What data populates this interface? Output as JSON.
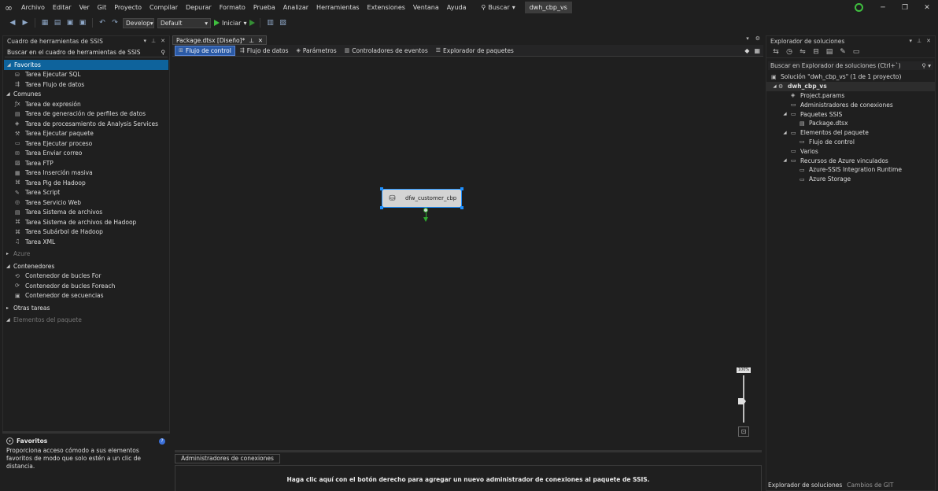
{
  "menubar": {
    "items": [
      "Archivo",
      "Editar",
      "Ver",
      "Git",
      "Proyecto",
      "Compilar",
      "Depurar",
      "Formato",
      "Prueba",
      "Analizar",
      "Herramientas",
      "Extensiones",
      "Ventana",
      "Ayuda"
    ],
    "search_label": "Buscar",
    "project_name": "dwh_cbp_vs"
  },
  "toolbar": {
    "config_combo": "Develop",
    "platform_combo": "Default",
    "start_label": "Iniciar"
  },
  "toolbox": {
    "title": "Cuadro de herramientas de SSIS",
    "search_placeholder": "Buscar en el cuadro de herramientas de SSIS",
    "categories": [
      {
        "label": "Favoritos",
        "items": [
          "Tarea Ejecutar SQL",
          "Tarea Flujo de datos"
        ]
      },
      {
        "label": "Comunes",
        "items": [
          "Tarea de expresión",
          "Tarea de generación de perfiles de datos",
          "Tarea de procesamiento de Analysis Services",
          "Tarea Ejecutar paquete",
          "Tarea Ejecutar proceso",
          "Tarea Enviar correo",
          "Tarea FTP",
          "Tarea Inserción masiva",
          "Tarea Pig de Hadoop",
          "Tarea Script",
          "Tarea Servicio Web",
          "Tarea Sistema de archivos",
          "Tarea Sistema de archivos de Hadoop",
          "Tarea Subárbol de Hadoop",
          "Tarea XML"
        ]
      },
      {
        "label": "Azure",
        "items": []
      },
      {
        "label": "Contenedores",
        "items": [
          "Contenedor de bucles For",
          "Contenedor de bucles Foreach",
          "Contenedor de secuencias"
        ]
      },
      {
        "label": "Otras tareas",
        "items": []
      },
      {
        "label": "Elementos del paquete",
        "items": []
      }
    ],
    "desc_title": "Favoritos",
    "desc_text": "Proporciona acceso cómodo a sus elementos favoritos de modo que solo estén a un clic de distancia."
  },
  "document": {
    "tab_label": "Package.dtsx [Diseño]*",
    "designer_tabs": [
      "Flujo de control",
      "Flujo de datos",
      "Parámetros",
      "Controladores de eventos",
      "Explorador de paquetes"
    ],
    "task_label": "dfw_customer_cbp",
    "zoom_label": "100%",
    "conn_tab": "Administradores de conexiones",
    "conn_message": "Haga clic aquí con el botón derecho para agregar un nuevo administrador de conexiones al paquete de SSIS."
  },
  "solution_explorer": {
    "title": "Explorador de soluciones",
    "search_placeholder": "Buscar en Explorador de soluciones (Ctrl+`)",
    "tree": [
      {
        "label": "Solución \"dwh_cbp_vs\"  (1 de 1 proyecto)"
      },
      {
        "label": "dwh_cbp_vs"
      },
      {
        "label": "Project.params"
      },
      {
        "label": "Administradores de conexiones"
      },
      {
        "label": "Paquetes SSIS"
      },
      {
        "label": "Package.dtsx"
      },
      {
        "label": "Elementos del paquete"
      },
      {
        "label": "Flujo de control"
      },
      {
        "label": "Varios"
      },
      {
        "label": "Recursos de Azure vinculados"
      },
      {
        "label": "Azure-SSIS Integration Runtime"
      },
      {
        "label": "Azure Storage"
      }
    ],
    "bottom_tabs": [
      "Explorador de soluciones",
      "Cambios de GIT"
    ]
  }
}
